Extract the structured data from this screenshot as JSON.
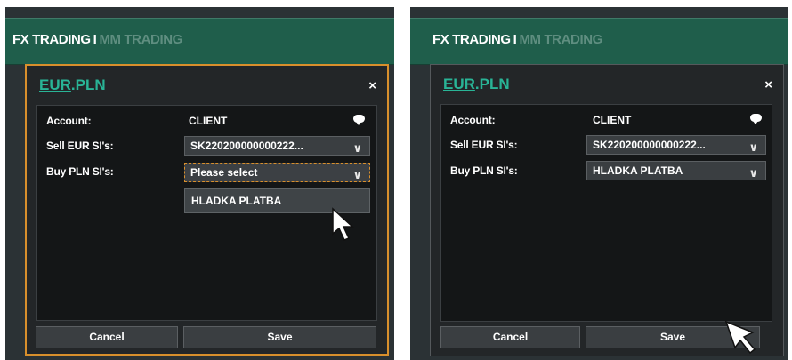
{
  "left_view": {
    "topbar": {
      "fx": "FX TRADING",
      "separator": "I",
      "mm": "MM TRADING"
    },
    "dialog": {
      "title_base": "EUR",
      "title_rest": ".PLN",
      "close": "×",
      "account_label": "Account:",
      "account_value": "CLIENT",
      "sell_label": "Sell EUR SI's:",
      "sell_value": "SK220200000000222...",
      "buy_label": "Buy PLN SI's:",
      "buy_value": "Please select",
      "dropdown_option": "HLADKA PLATBA",
      "cancel": "Cancel",
      "save": "Save"
    }
  },
  "right_view": {
    "topbar": {
      "fx": "FX TRADING",
      "separator": "I",
      "mm": "MM TRADING"
    },
    "dialog": {
      "title_base": "EUR",
      "title_rest": ".PLN",
      "close": "×",
      "account_label": "Account:",
      "account_value": "CLIENT",
      "sell_label": "Sell EUR SI's:",
      "sell_value": "SK220200000000222...",
      "buy_label": "Buy PLN SI's:",
      "buy_value": "HLADKA PLATBA",
      "cancel": "Cancel",
      "save": "Save"
    }
  },
  "icons": {
    "chevron": "chevron-down-icon",
    "comment": "comment-icon",
    "cursor": "mouse-pointer-icon"
  },
  "colors": {
    "accent_green": "#29b496",
    "focus_orange": "#d88f2c",
    "topbar": "#1f5e4b"
  }
}
